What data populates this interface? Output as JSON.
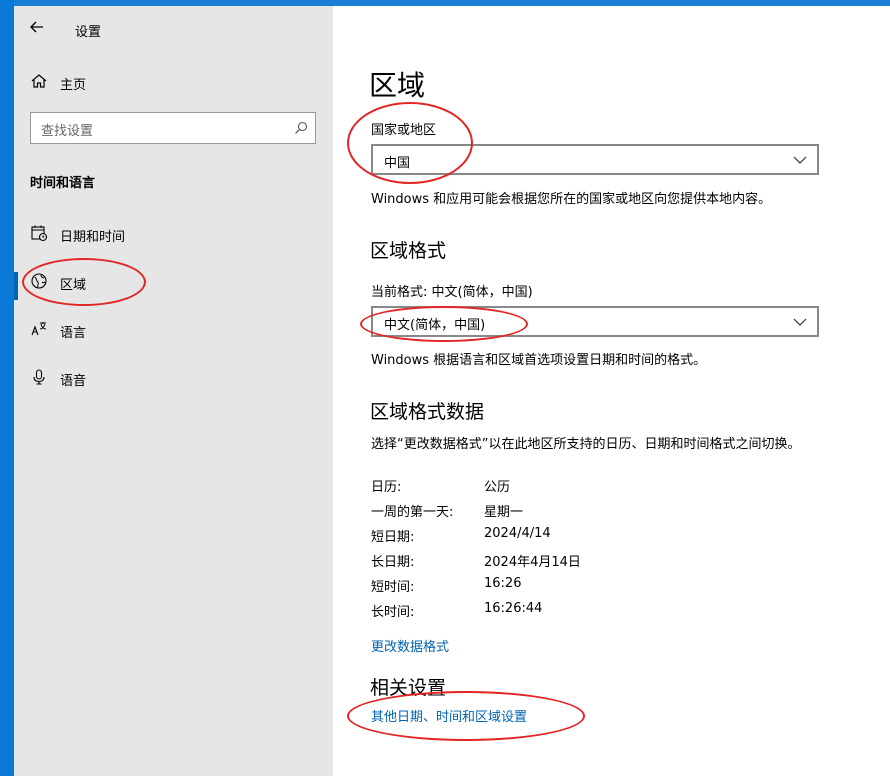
{
  "window": {
    "title": "设置",
    "back_icon": "back-arrow-icon"
  },
  "sidebar": {
    "home_label": "主页",
    "search_placeholder": "查找设置",
    "section_title": "时间和语言",
    "items": [
      {
        "label": "日期和时间",
        "icon": "calendar-clock-icon"
      },
      {
        "label": "区域",
        "icon": "globe-icon",
        "selected": true
      },
      {
        "label": "语言",
        "icon": "language-icon"
      },
      {
        "label": "语音",
        "icon": "microphone-icon"
      }
    ]
  },
  "main": {
    "page_title": "区域",
    "country": {
      "label": "国家或地区",
      "value": "中国",
      "description": "Windows 和应用可能会根据您所在的国家或地区向您提供本地内容。"
    },
    "format": {
      "heading": "区域格式",
      "current_label": "当前格式: 中文(简体，中国)",
      "value": "中文(简体，中国)",
      "description": "Windows 根据语言和区域首选项设置日期和时间的格式。"
    },
    "format_data": {
      "heading": "区域格式数据",
      "description": "选择“更改数据格式”以在此地区所支持的日历、日期和时间格式之间切换。",
      "rows": [
        {
          "key": "日历:",
          "value": "公历"
        },
        {
          "key": "一周的第一天:",
          "value": "星期一"
        },
        {
          "key": "短日期:",
          "value": "2024/4/14"
        },
        {
          "key": "长日期:",
          "value": "2024年4月14日"
        },
        {
          "key": "短时间:",
          "value": "16:26"
        },
        {
          "key": "长时间:",
          "value": "16:26:44"
        }
      ],
      "change_link": "更改数据格式"
    },
    "related": {
      "heading": "相关设置",
      "link": "其他日期、时间和区域设置"
    }
  },
  "colors": {
    "accent": "#0063b1",
    "annotation": "#e22525",
    "sidebar_bg": "#e6e6e6",
    "desktop": "#0a78d7"
  }
}
